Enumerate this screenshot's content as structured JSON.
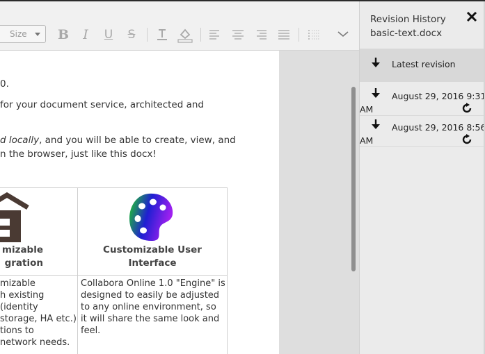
{
  "toolbar": {
    "font_size_placeholder": "Size",
    "buttons": [
      {
        "name": "bold-button",
        "icon": "bold-icon"
      },
      {
        "name": "italic-button",
        "icon": "italic-icon"
      },
      {
        "name": "underline-button",
        "icon": "underline-icon"
      },
      {
        "name": "strikethrough-button",
        "icon": "strikethrough-icon"
      },
      {
        "name": "font-color-button",
        "icon": "text-color-icon"
      },
      {
        "name": "highlight-button",
        "icon": "paint-bucket-icon"
      },
      {
        "name": "align-left-button",
        "icon": "align-left-icon"
      },
      {
        "name": "align-center-button",
        "icon": "align-center-icon"
      },
      {
        "name": "align-right-button",
        "icon": "align-right-icon"
      },
      {
        "name": "justify-button",
        "icon": "justify-icon"
      },
      {
        "name": "numbered-list-button",
        "icon": "list-icon"
      },
      {
        "name": "more-button",
        "icon": "chevron-down-icon"
      }
    ]
  },
  "document": {
    "lines": [
      {
        "text": "0."
      },
      {
        "text": " for your document service, architected and"
      },
      {
        "italic": "d locally",
        "text": ", and you will be able to create, view, and"
      },
      {
        "text": "n the browser, just like this docx!"
      }
    ],
    "table": {
      "headers": [
        {
          "line1": "mizable",
          "line2": "gration"
        },
        {
          "line1": "Customizable User",
          "line2": "Interface"
        }
      ],
      "cells": [
        [
          "mizable",
          "h existing",
          " (identity",
          "storage, HA etc.)",
          "tions to",
          "network needs."
        ],
        [
          "Collabora Online 1.0 \"Engine\" is",
          "designed to easily be adjusted",
          "to any online environment, so",
          "it will share the same look and",
          "feel."
        ]
      ]
    }
  },
  "sidebar": {
    "title": "Revision History",
    "filename": "basic-text.docx",
    "latest_label": "Latest revision",
    "revisions": [
      {
        "line1": "August 29, 2016 9:31",
        "line2": "AM"
      },
      {
        "line1": "August 29, 2016 8:56",
        "line2": "AM"
      }
    ]
  },
  "colors": {
    "palette_gradient": [
      "#1fd21f",
      "#1f1fd2",
      "#a020f0"
    ],
    "house_icon": "#4a3a33"
  }
}
